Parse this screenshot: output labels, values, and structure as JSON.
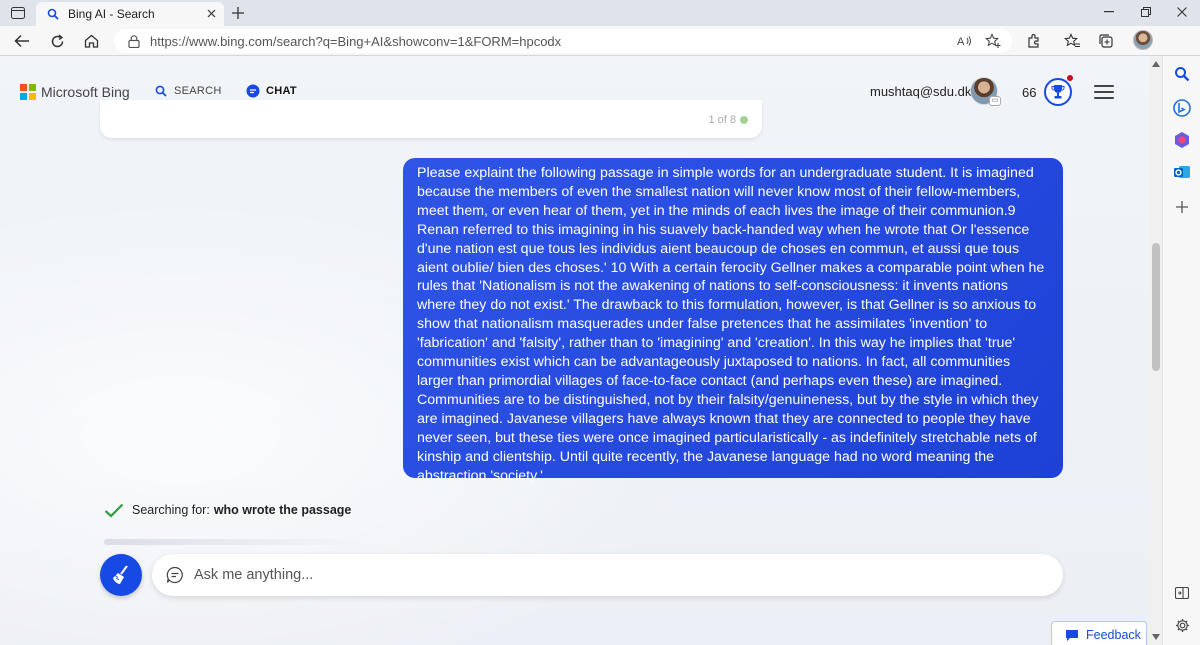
{
  "browser": {
    "tab_title": "Bing AI - Search",
    "url": "https://www.bing.com/search?q=Bing+AI&showconv=1&FORM=hpcodx"
  },
  "header": {
    "brand": "Microsoft Bing",
    "nav_search": "SEARCH",
    "nav_chat": "CHAT",
    "account_email": "mushtaq@sdu.dk",
    "rewards_points": "66"
  },
  "previous_card": {
    "count": "1 of 8"
  },
  "user_message": "Please explaint the following passage in simple words for an undergraduate student. It is imagined because the members of even the smallest nation will never know most of their fellow-members, meet them, or even hear of them, yet in the minds of each lives the image of their communion.9 Renan referred to this imagining in his suavely back-handed way when he wrote that Or l'essence d'une nation est que tous les individus aient beaucoup de choses en commun, et aussi que tous aient oublie/ bien des choses.' 10 With a certain ferocity Gellner makes a comparable point when he rules that 'Nationalism is not the awakening of nations to self-consciousness: it invents nations where they do not exist.' The drawback to this formulation, however, is that Gellner is so anxious to show that nationalism masquerades under false pretences that he assimilates 'invention' to 'fabrication' and 'falsity', rather than to 'imagining' and 'creation'. In this way he implies that 'true' communities exist which can be advantageously juxtaposed to nations. In fact, all communities larger than primordial villages of face-to-face contact (and perhaps even these) are imagined. Communities are to be distinguished, not by their falsity/genuineness, but by the style in which they are imagined. Javanese villagers have always known that they are connected to people they have never seen, but these ties were once imagined particularistically - as indefinitely stretchable nets of kinship and clientship. Until quite recently, the Javanese language had no word meaning the abstraction 'society.'",
  "status": {
    "prefix": "Searching for:",
    "query": "who wrote the passage"
  },
  "composer": {
    "placeholder": "Ask me anything..."
  },
  "feedback_label": "Feedback",
  "colors": {
    "accent": "#174ae4",
    "bubble": "#2448e0",
    "check": "#2e9e44"
  }
}
